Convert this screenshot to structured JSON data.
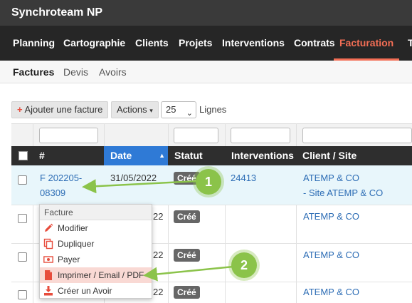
{
  "app": {
    "title": "Synchroteam NP"
  },
  "nav": {
    "items": [
      {
        "label": "Planning"
      },
      {
        "label": "Cartographie"
      },
      {
        "label": "Clients"
      },
      {
        "label": "Projets"
      },
      {
        "label": "Interventions"
      },
      {
        "label": "Contrats"
      },
      {
        "label": "Facturation",
        "active": true
      },
      {
        "label": "T"
      }
    ]
  },
  "subnav": {
    "items": [
      {
        "label": "Factures",
        "active": true
      },
      {
        "label": "Devis"
      },
      {
        "label": "Avoirs"
      }
    ]
  },
  "toolbar": {
    "add_label": "Ajouter une facture",
    "add_icon": "+",
    "actions_label": "Actions",
    "rows_value": "25",
    "rows_suffix": "Lignes"
  },
  "table": {
    "columns": [
      "#",
      "Date",
      "Statut",
      "Interventions",
      "Client / Site"
    ],
    "sorted_column": "Date",
    "rows": [
      {
        "number_line1": "F 202205-",
        "number_line2": "08309",
        "date": "31/05/2022",
        "status": "Créé",
        "intervention": "24413",
        "client": "ATEMP & CO",
        "site": "- Site ATEMP & CO"
      },
      {
        "date": "22",
        "status": "Créé",
        "client": "ATEMP & CO"
      },
      {
        "date": "22",
        "status": "Créé",
        "client": "ATEMP & CO"
      },
      {
        "date": "22",
        "status": "Créé",
        "client": "ATEMP & CO"
      }
    ]
  },
  "context_menu": {
    "header": "Facture",
    "items": [
      {
        "label": "Modifier",
        "icon": "pencil-icon"
      },
      {
        "label": "Dupliquer",
        "icon": "copy-icon"
      },
      {
        "label": "Payer",
        "icon": "money-icon"
      },
      {
        "label": "Imprimer / Email / PDF",
        "icon": "file-icon",
        "highlighted": true
      },
      {
        "label": "Créer un Avoir",
        "icon": "download-icon"
      }
    ]
  },
  "callouts": {
    "one": "1",
    "two": "2"
  },
  "colors": {
    "accent": "#f36e55",
    "sorted_header": "#2f7ad6",
    "link": "#2d6db5",
    "callout": "#8bc34a",
    "menu_hover": "#f9d9d4"
  }
}
